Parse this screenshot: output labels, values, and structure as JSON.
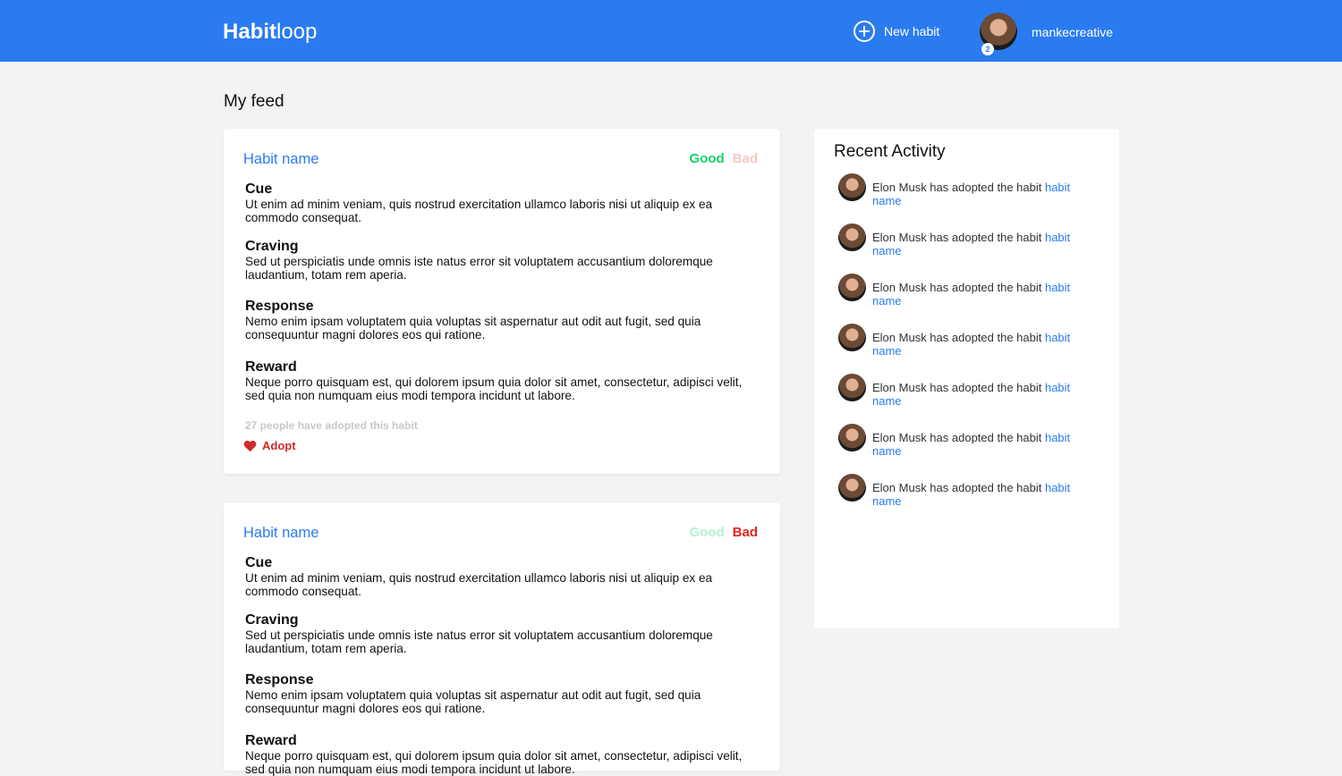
{
  "header": {
    "logo_bold": "Habit",
    "logo_light": "loop",
    "new_habit": "New habit",
    "username": "mankecreative",
    "notification_count": "2"
  },
  "feed": {
    "title": "My feed",
    "cards": [
      {
        "name": "Habit name",
        "good": "Good",
        "bad": "Bad",
        "selected": "good",
        "cue_title": "Cue",
        "cue": "Ut enim ad minim veniam, quis nostrud exercitation ullamco laboris nisi ut aliquip ex ea commodo consequat.",
        "craving_title": "Craving",
        "craving": "Sed ut perspiciatis unde omnis iste natus error sit voluptatem accusantium doloremque laudantium, totam rem aperia.",
        "response_title": "Response",
        "response": "Nemo enim ipsam voluptatem quia voluptas sit aspernatur aut odit aut fugit, sed quia consequuntur magni dolores eos qui ratione.",
        "reward_title": "Reward",
        "reward": "Neque porro quisquam est, qui dolorem ipsum quia dolor sit amet, consectetur, adipisci velit, sed quia non numquam eius modi tempora incidunt ut labore.",
        "adopted_count": "27 people have adopted this habit",
        "adopt_label": "Adopt"
      },
      {
        "name": "Habit name",
        "good": "Good",
        "bad": "Bad",
        "selected": "bad",
        "cue_title": "Cue",
        "cue": "Ut enim ad minim veniam, quis nostrud exercitation ullamco laboris nisi ut aliquip ex ea commodo consequat.",
        "craving_title": "Craving",
        "craving": "Sed ut perspiciatis unde omnis iste natus error sit voluptatem accusantium doloremque laudantium, totam rem aperia.",
        "response_title": "Response",
        "response": "Nemo enim ipsam voluptatem quia voluptas sit aspernatur aut odit aut fugit, sed quia consequuntur magni dolores eos qui ratione.",
        "reward_title": "Reward",
        "reward": "Neque porro quisquam est, qui dolorem ipsum quia dolor sit amet, consectetur, adipisci velit, sed quia non numquam eius modi tempora incidunt ut labore."
      }
    ]
  },
  "activity": {
    "title": "Recent Activity",
    "items": [
      {
        "text": "Elon Musk has adopted the habit ",
        "link": "habit name"
      },
      {
        "text": "Elon Musk has adopted the habit ",
        "link": "habit name"
      },
      {
        "text": "Elon Musk has adopted the habit ",
        "link": "habit name"
      },
      {
        "text": "Elon Musk has adopted the habit ",
        "link": "habit name"
      },
      {
        "text": "Elon Musk has adopted the habit ",
        "link": "habit name"
      },
      {
        "text": "Elon Musk has adopted the habit ",
        "link": "habit name"
      },
      {
        "text": "Elon Musk has adopted the habit ",
        "link": "habit name"
      }
    ]
  }
}
